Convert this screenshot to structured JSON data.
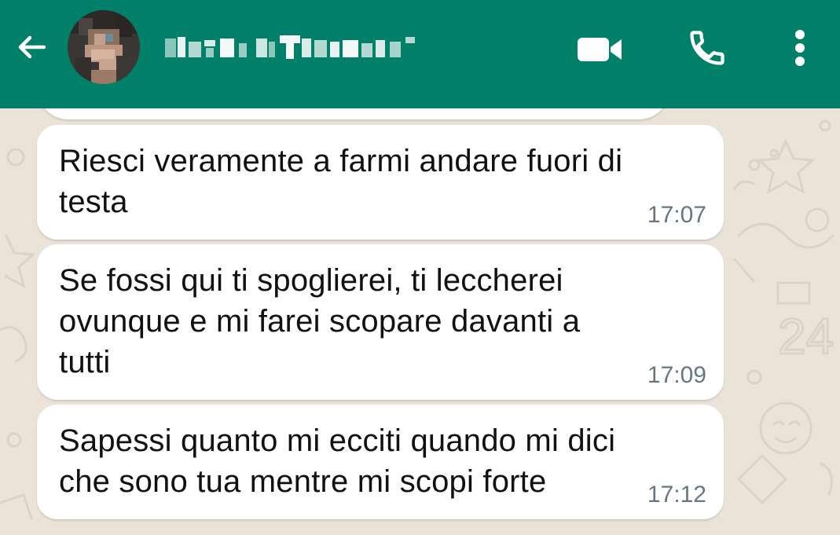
{
  "header": {
    "contact_name": "",
    "accent_color": "#008069",
    "icons": {
      "back": "arrow-back-icon",
      "video": "video-camera-icon",
      "call": "phone-icon",
      "menu": "more-vert-icon"
    }
  },
  "messages": [
    {
      "text": "Riesci veramente a farmi andare fuori di\ntesta",
      "time": "17:07"
    },
    {
      "text": "Se fossi qui ti spoglierei, ti leccherei\novunque e mi farei scopare davanti a\ntutti",
      "time": "17:09"
    },
    {
      "text": "Sapessi quanto mi ecciti quando mi dici\nche sono tua mentre mi scopi forte",
      "time": "17:12"
    }
  ]
}
